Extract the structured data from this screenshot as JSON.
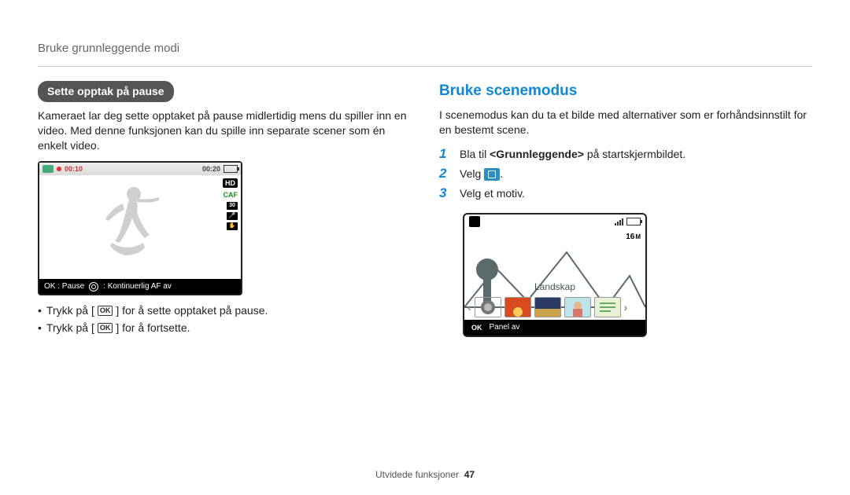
{
  "breadcrumb": "Bruke grunnleggende modi",
  "left": {
    "pill": "Sette opptak på pause",
    "para": "Kameraet lar deg sette opptaket på pause midlertidig mens du spiller inn en video. Med denne funksjonen kan du spille inn separate scener som én enkelt video.",
    "lcd": {
      "time_elapsed": "00:10",
      "time_total": "00:20",
      "hd": "HD",
      "caf": "CAF",
      "thirty": "30",
      "footer_pause": "OK : Pause",
      "footer_af": ": Kontinuerlig AF av"
    },
    "bullet1_a": "Trykk på [",
    "bullet1_ok": "OK",
    "bullet1_b": "] for å sette opptaket på pause.",
    "bullet2_a": "Trykk på [",
    "bullet2_ok": "OK",
    "bullet2_b": "] for å fortsette."
  },
  "right": {
    "heading": "Bruke scenemodus",
    "para": "I scenemodus kan du ta et bilde med alternativer som er forhåndsinnstilt for en bestemt scene.",
    "steps": {
      "s1_a": "Bla til ",
      "s1_b": "<Grunnleggende>",
      "s1_c": " på startskjermbildet.",
      "s2_a": "Velg ",
      "s2_b": ".",
      "s3": "Velg et motiv."
    },
    "lcd": {
      "sixteen": "16",
      "label": "Landskap",
      "footer_ok": "OK",
      "footer_panel": "Panel av"
    }
  },
  "footer": {
    "section": "Utvidede funksjoner",
    "page": "47"
  },
  "chart_data": null
}
